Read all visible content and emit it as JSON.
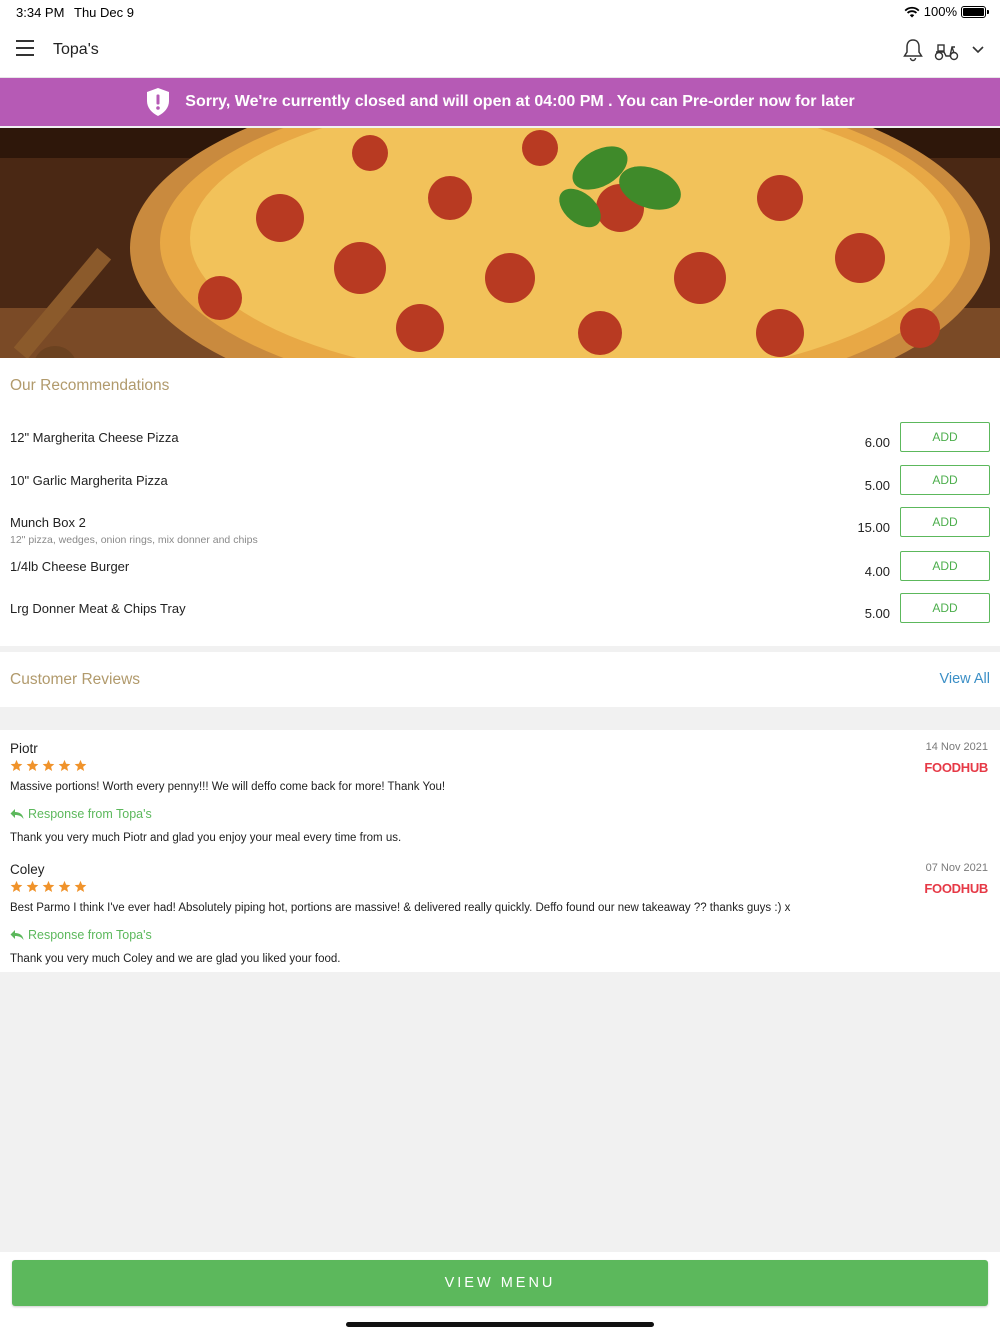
{
  "status_bar": {
    "time": "3:34 PM",
    "date": "Thu Dec 9",
    "battery": "100%"
  },
  "header": {
    "title": "Topa's"
  },
  "banner": {
    "message": "Sorry, We're currently closed and will open at 04:00 PM . You can Pre-order now for later",
    "color": "#b65ab5"
  },
  "recommendations": {
    "title": "Our Recommendations",
    "items": [
      {
        "name": "12\" Margherita Cheese Pizza",
        "description": "",
        "price": "6.00",
        "button": "ADD"
      },
      {
        "name": "10\" Garlic Margherita Pizza",
        "description": "",
        "price": "5.00",
        "button": "ADD"
      },
      {
        "name": "Munch Box 2",
        "description": "12\" pizza, wedges, onion rings, mix donner and chips",
        "price": "15.00",
        "button": "ADD"
      },
      {
        "name": "1/4lb Cheese Burger",
        "description": "",
        "price": "4.00",
        "button": "ADD"
      },
      {
        "name": "Lrg Donner Meat & Chips Tray",
        "description": "",
        "price": "5.00",
        "button": "ADD"
      }
    ]
  },
  "reviews": {
    "title": "Customer Reviews",
    "view_all": "View All",
    "items": [
      {
        "author": "Piotr",
        "date": "14 Nov 2021",
        "source": "FOODHUB",
        "rating": 5,
        "text": "Massive portions! Worth every penny!!! We will deffo come back for more! Thank You!",
        "response_label": "Response from Topa's",
        "response": "Thank you very much Piotr and glad you enjoy your meal every time from us."
      },
      {
        "author": "Coley",
        "date": "07 Nov 2021",
        "source": "FOODHUB",
        "rating": 5,
        "text": "Best Parmo I think I've ever had! Absolutely piping hot, portions are massive! & delivered really quickly. Deffo found our new takeaway ??  thanks guys :) x",
        "response_label": "Response from Topa's",
        "response": "Thank you very  much Coley and we are glad you liked your food."
      }
    ]
  },
  "footer": {
    "button": "VIEW MENU",
    "accent": "#5cb85c"
  }
}
